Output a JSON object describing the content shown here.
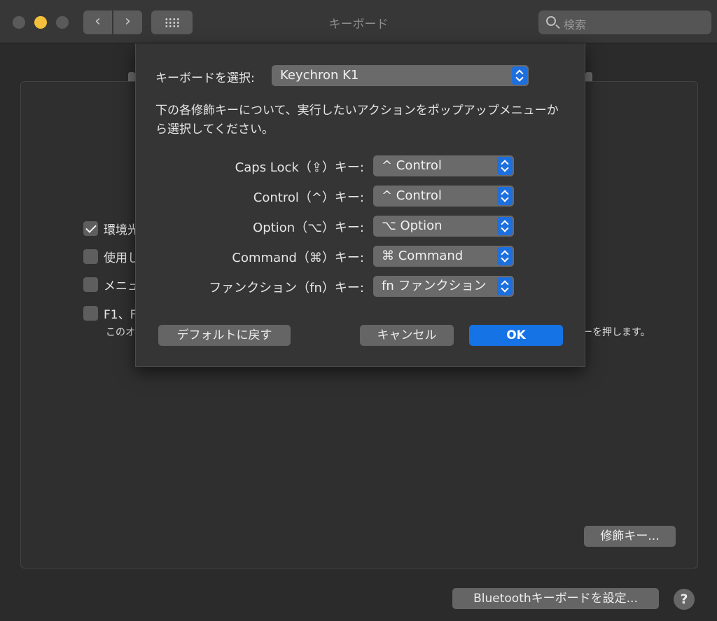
{
  "window": {
    "title": "キーボード"
  },
  "toolbar": {
    "back": "‹",
    "forward": "›",
    "search_placeholder": "検索"
  },
  "pane": {
    "checkboxes": [
      {
        "label": "環境光",
        "checked": true
      },
      {
        "label": "使用し",
        "checked": false
      },
      {
        "label": "メニュ",
        "checked": false
      },
      {
        "label": "F1、F",
        "checked": false
      }
    ],
    "note_start": "このオ",
    "note_end": "ーを押します。",
    "modifier_keys_button": "修飾キー...",
    "bluetooth_button": "Bluetoothキーボードを設定...",
    "help_button": "?"
  },
  "sheet": {
    "keyboard_select_label": "キーボードを選択:",
    "keyboard_selected": "Keychron K1",
    "description": "下の各修飾キーについて、実行したいアクションをポップアップメニューから選択してください。",
    "modifiers": [
      {
        "label": "Caps Lock（⇪）キー:",
        "value": "^ Control"
      },
      {
        "label": "Control（^）キー:",
        "value": "^ Control"
      },
      {
        "label": "Option（⌥）キー:",
        "value": "⌥ Option"
      },
      {
        "label": "Command（⌘）キー:",
        "value": "⌘ Command"
      },
      {
        "label": "ファンクション（fn）キー:",
        "value": "fn ファンクション"
      }
    ],
    "restore_defaults": "デフォルトに戻す",
    "cancel": "キャンセル",
    "ok": "OK"
  },
  "colors": {
    "accent": "#1673e6",
    "popup_arrows": "#1e6fde",
    "minimize": "#f4bf3b"
  }
}
